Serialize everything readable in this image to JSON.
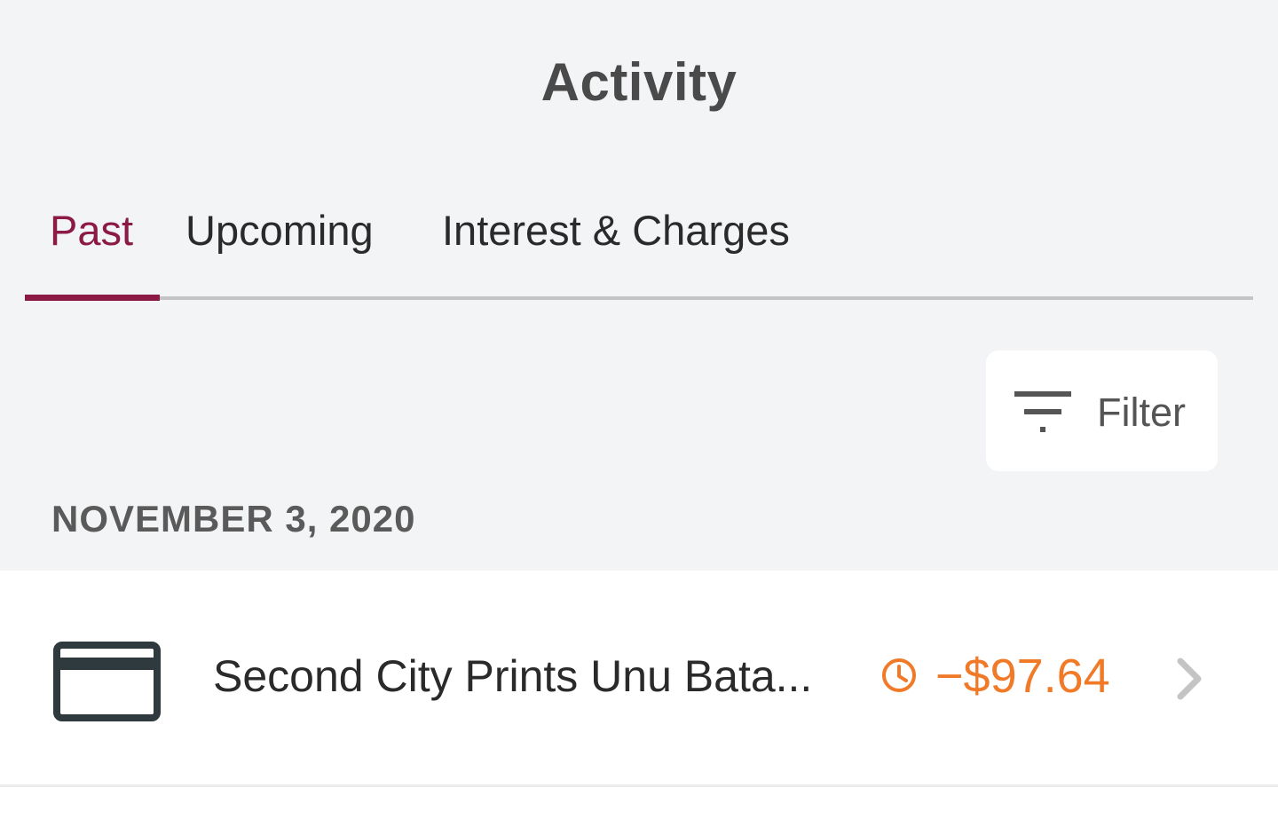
{
  "header": {
    "title": "Activity"
  },
  "tabs": [
    {
      "label": "Past",
      "active": true
    },
    {
      "label": "Upcoming",
      "active": false
    },
    {
      "label": "Interest & Charges",
      "active": false
    }
  ],
  "filter": {
    "label": "Filter",
    "icon": "filter-icon"
  },
  "groups": [
    {
      "date": "NOVEMBER 3, 2020",
      "transactions": [
        {
          "icon": "credit-card-icon",
          "merchant": "Second City Prints Unu Bata...",
          "status_icon": "clock-icon",
          "amount": "−$97.64"
        }
      ]
    }
  ],
  "colors": {
    "accent": "#8b1a45",
    "pending": "#f07a28",
    "background": "#f3f4f6"
  }
}
